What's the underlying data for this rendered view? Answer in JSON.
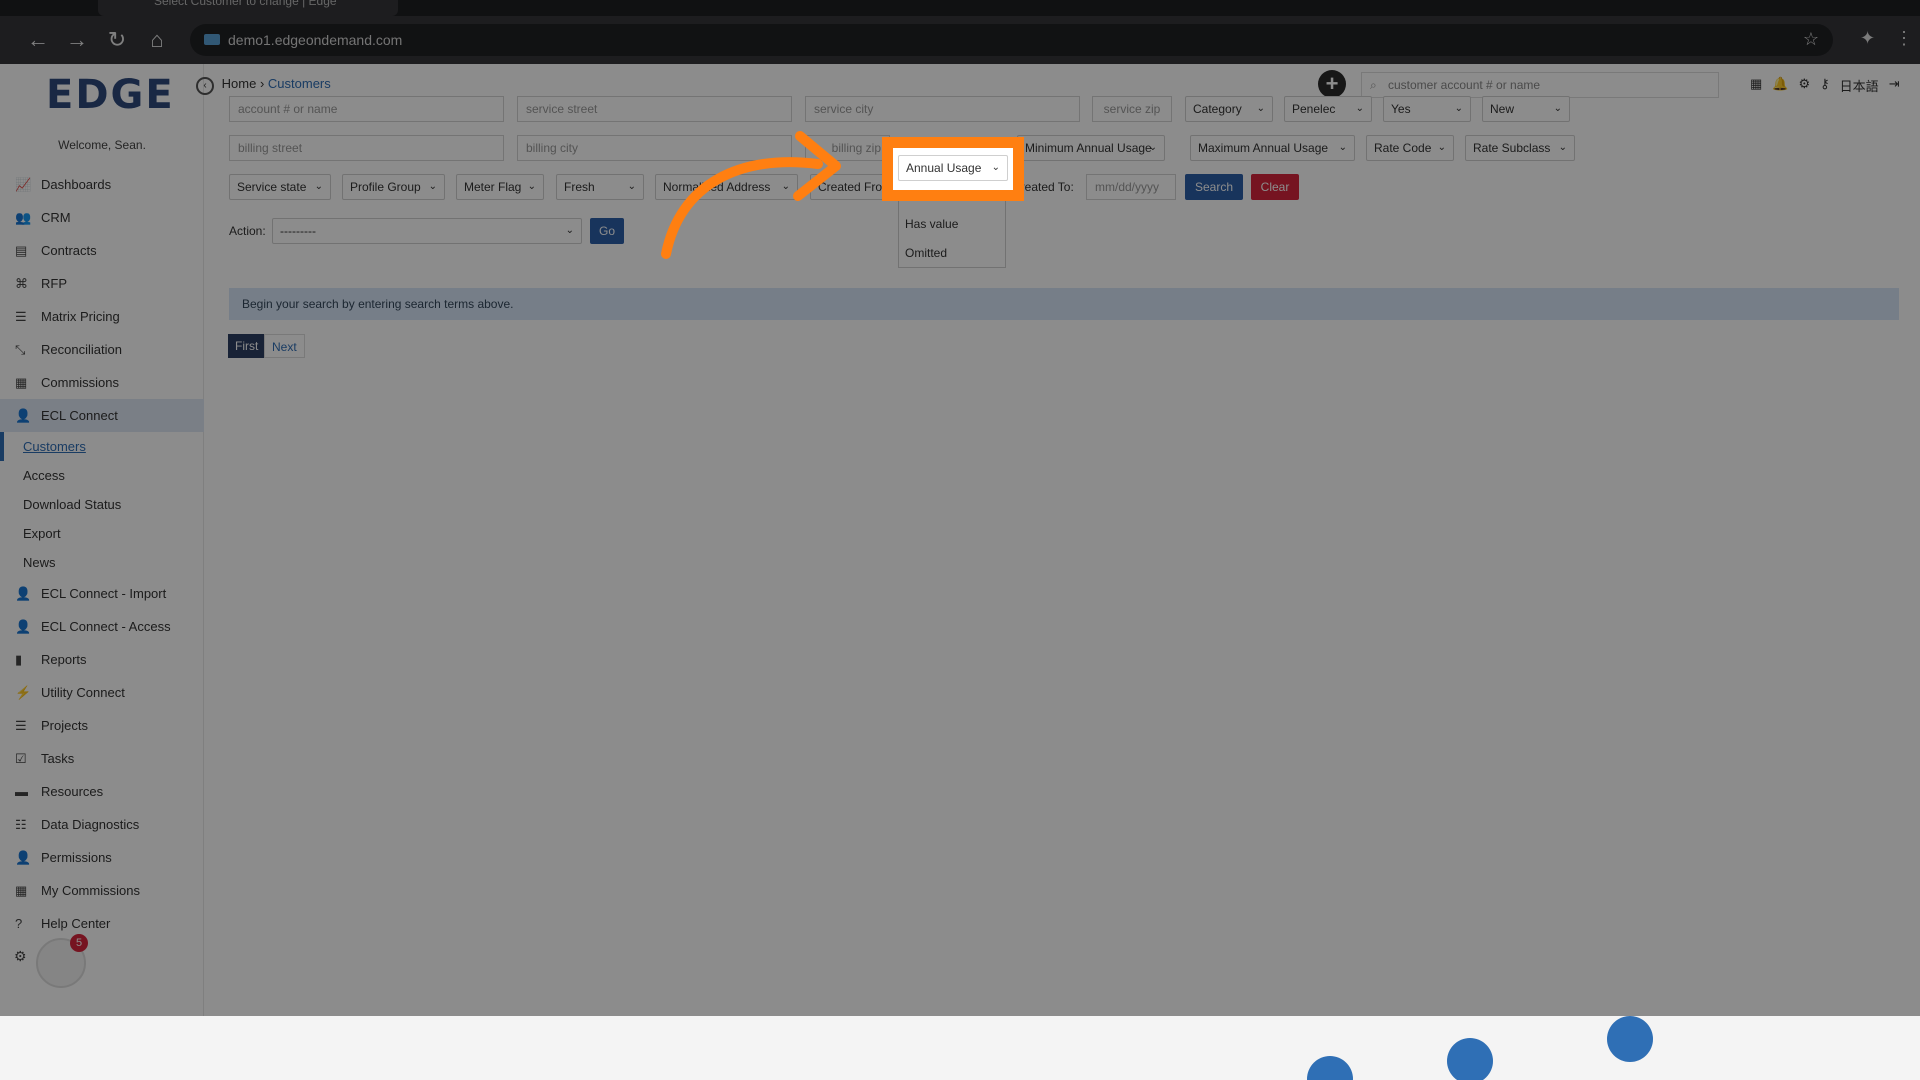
{
  "browser": {
    "tab_title": "Select Customer to change | Edge",
    "url": "demo1.edgeondemand.com"
  },
  "brand": {
    "logo": "EDGE",
    "welcome": "Welcome, Sean."
  },
  "sidebar": {
    "items": [
      {
        "label": "Dashboards",
        "icon": "chart-line-icon"
      },
      {
        "label": "CRM",
        "icon": "users-icon"
      },
      {
        "label": "Contracts",
        "icon": "document-icon"
      },
      {
        "label": "RFP",
        "icon": "sitemap-icon"
      },
      {
        "label": "Matrix Pricing",
        "icon": "list-icon"
      },
      {
        "label": "Reconciliation",
        "icon": "compress-icon"
      },
      {
        "label": "Commissions",
        "icon": "money-icon"
      },
      {
        "label": "ECL Connect",
        "icon": "user-connect-icon"
      }
    ],
    "subitems": [
      "Customers",
      "Access",
      "Download Status",
      "Export",
      "News"
    ],
    "items_after": [
      {
        "label": "ECL Connect - Import",
        "icon": "user-connect-icon"
      },
      {
        "label": "ECL Connect - Access",
        "icon": "user-connect-icon"
      },
      {
        "label": "Reports",
        "icon": "bar-chart-icon"
      },
      {
        "label": "Utility Connect",
        "icon": "plug-icon"
      },
      {
        "label": "Projects",
        "icon": "tasks-icon"
      },
      {
        "label": "Tasks",
        "icon": "checklist-icon"
      },
      {
        "label": "Resources",
        "icon": "folder-icon"
      },
      {
        "label": "Data Diagnostics",
        "icon": "database-icon"
      },
      {
        "label": "Permissions",
        "icon": "user-lock-icon"
      },
      {
        "label": "My Commissions",
        "icon": "money-icon"
      },
      {
        "label": "Help Center",
        "icon": "question-icon"
      }
    ],
    "notification_count": "5"
  },
  "header": {
    "breadcrumb_home": "Home",
    "breadcrumb_sep": "›",
    "breadcrumb_current": "Customers",
    "search_placeholder": "customer account # or name",
    "language": "日本語"
  },
  "filters": {
    "account_placeholder": "account # or name",
    "service_street_placeholder": "service street",
    "service_city_placeholder": "service city",
    "service_zip_placeholder": "service zip",
    "category": "Category",
    "utility": "Penelec",
    "yes_select": "Yes",
    "status_select": "New",
    "billing_street_placeholder": "billing street",
    "billing_city_placeholder": "billing city",
    "billing_zip_placeholder": "billing zip",
    "annual_usage": "Annual Usage",
    "min_annual_usage": "Minimum Annual Usage",
    "max_annual_usage": "Maximum Annual Usage",
    "rate_code": "Rate Code",
    "rate_subclass": "Rate Subclass",
    "service_state": "Service state",
    "profile_group": "Profile Group",
    "meter_flag": "Meter Flag",
    "fresh": "Fresh",
    "normalized_address": "Normalized Address",
    "created_from": "Created From:",
    "created_to": "Created To:",
    "date_placeholder": "mm/dd/yyyy",
    "search_button": "Search",
    "clear_button": "Clear"
  },
  "dropdown_options": [
    "Has value",
    "Omitted"
  ],
  "action": {
    "label": "Action:",
    "value": "---------",
    "go": "Go"
  },
  "info_message": "Begin your search by entering search terms above.",
  "pagination": {
    "first": "First",
    "next": "Next"
  },
  "colors": {
    "accent": "#2f6db5",
    "highlight": "#ff7f11",
    "danger": "#d7263d",
    "search_button": "#2d5fa8"
  }
}
